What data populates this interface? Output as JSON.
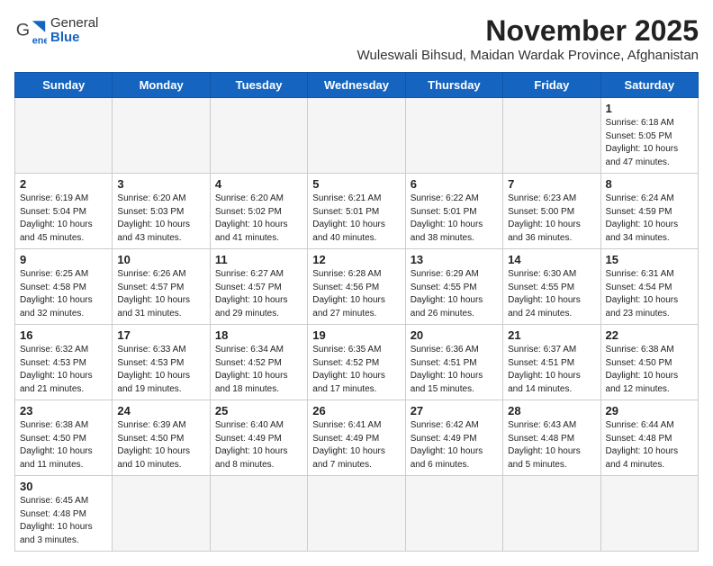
{
  "header": {
    "logo_general": "General",
    "logo_blue": "Blue",
    "month_title": "November 2025",
    "location": "Wuleswali Bihsud, Maidan Wardak Province, Afghanistan"
  },
  "weekdays": [
    "Sunday",
    "Monday",
    "Tuesday",
    "Wednesday",
    "Thursday",
    "Friday",
    "Saturday"
  ],
  "weeks": [
    [
      {
        "day": "",
        "info": ""
      },
      {
        "day": "",
        "info": ""
      },
      {
        "day": "",
        "info": ""
      },
      {
        "day": "",
        "info": ""
      },
      {
        "day": "",
        "info": ""
      },
      {
        "day": "",
        "info": ""
      },
      {
        "day": "1",
        "info": "Sunrise: 6:18 AM\nSunset: 5:05 PM\nDaylight: 10 hours and 47 minutes."
      }
    ],
    [
      {
        "day": "2",
        "info": "Sunrise: 6:19 AM\nSunset: 5:04 PM\nDaylight: 10 hours and 45 minutes."
      },
      {
        "day": "3",
        "info": "Sunrise: 6:20 AM\nSunset: 5:03 PM\nDaylight: 10 hours and 43 minutes."
      },
      {
        "day": "4",
        "info": "Sunrise: 6:20 AM\nSunset: 5:02 PM\nDaylight: 10 hours and 41 minutes."
      },
      {
        "day": "5",
        "info": "Sunrise: 6:21 AM\nSunset: 5:01 PM\nDaylight: 10 hours and 40 minutes."
      },
      {
        "day": "6",
        "info": "Sunrise: 6:22 AM\nSunset: 5:01 PM\nDaylight: 10 hours and 38 minutes."
      },
      {
        "day": "7",
        "info": "Sunrise: 6:23 AM\nSunset: 5:00 PM\nDaylight: 10 hours and 36 minutes."
      },
      {
        "day": "8",
        "info": "Sunrise: 6:24 AM\nSunset: 4:59 PM\nDaylight: 10 hours and 34 minutes."
      }
    ],
    [
      {
        "day": "9",
        "info": "Sunrise: 6:25 AM\nSunset: 4:58 PM\nDaylight: 10 hours and 32 minutes."
      },
      {
        "day": "10",
        "info": "Sunrise: 6:26 AM\nSunset: 4:57 PM\nDaylight: 10 hours and 31 minutes."
      },
      {
        "day": "11",
        "info": "Sunrise: 6:27 AM\nSunset: 4:57 PM\nDaylight: 10 hours and 29 minutes."
      },
      {
        "day": "12",
        "info": "Sunrise: 6:28 AM\nSunset: 4:56 PM\nDaylight: 10 hours and 27 minutes."
      },
      {
        "day": "13",
        "info": "Sunrise: 6:29 AM\nSunset: 4:55 PM\nDaylight: 10 hours and 26 minutes."
      },
      {
        "day": "14",
        "info": "Sunrise: 6:30 AM\nSunset: 4:55 PM\nDaylight: 10 hours and 24 minutes."
      },
      {
        "day": "15",
        "info": "Sunrise: 6:31 AM\nSunset: 4:54 PM\nDaylight: 10 hours and 23 minutes."
      }
    ],
    [
      {
        "day": "16",
        "info": "Sunrise: 6:32 AM\nSunset: 4:53 PM\nDaylight: 10 hours and 21 minutes."
      },
      {
        "day": "17",
        "info": "Sunrise: 6:33 AM\nSunset: 4:53 PM\nDaylight: 10 hours and 19 minutes."
      },
      {
        "day": "18",
        "info": "Sunrise: 6:34 AM\nSunset: 4:52 PM\nDaylight: 10 hours and 18 minutes."
      },
      {
        "day": "19",
        "info": "Sunrise: 6:35 AM\nSunset: 4:52 PM\nDaylight: 10 hours and 17 minutes."
      },
      {
        "day": "20",
        "info": "Sunrise: 6:36 AM\nSunset: 4:51 PM\nDaylight: 10 hours and 15 minutes."
      },
      {
        "day": "21",
        "info": "Sunrise: 6:37 AM\nSunset: 4:51 PM\nDaylight: 10 hours and 14 minutes."
      },
      {
        "day": "22",
        "info": "Sunrise: 6:38 AM\nSunset: 4:50 PM\nDaylight: 10 hours and 12 minutes."
      }
    ],
    [
      {
        "day": "23",
        "info": "Sunrise: 6:38 AM\nSunset: 4:50 PM\nDaylight: 10 hours and 11 minutes."
      },
      {
        "day": "24",
        "info": "Sunrise: 6:39 AM\nSunset: 4:50 PM\nDaylight: 10 hours and 10 minutes."
      },
      {
        "day": "25",
        "info": "Sunrise: 6:40 AM\nSunset: 4:49 PM\nDaylight: 10 hours and 8 minutes."
      },
      {
        "day": "26",
        "info": "Sunrise: 6:41 AM\nSunset: 4:49 PM\nDaylight: 10 hours and 7 minutes."
      },
      {
        "day": "27",
        "info": "Sunrise: 6:42 AM\nSunset: 4:49 PM\nDaylight: 10 hours and 6 minutes."
      },
      {
        "day": "28",
        "info": "Sunrise: 6:43 AM\nSunset: 4:48 PM\nDaylight: 10 hours and 5 minutes."
      },
      {
        "day": "29",
        "info": "Sunrise: 6:44 AM\nSunset: 4:48 PM\nDaylight: 10 hours and 4 minutes."
      }
    ],
    [
      {
        "day": "30",
        "info": "Sunrise: 6:45 AM\nSunset: 4:48 PM\nDaylight: 10 hours and 3 minutes."
      },
      {
        "day": "",
        "info": ""
      },
      {
        "day": "",
        "info": ""
      },
      {
        "day": "",
        "info": ""
      },
      {
        "day": "",
        "info": ""
      },
      {
        "day": "",
        "info": ""
      },
      {
        "day": "",
        "info": ""
      }
    ]
  ]
}
